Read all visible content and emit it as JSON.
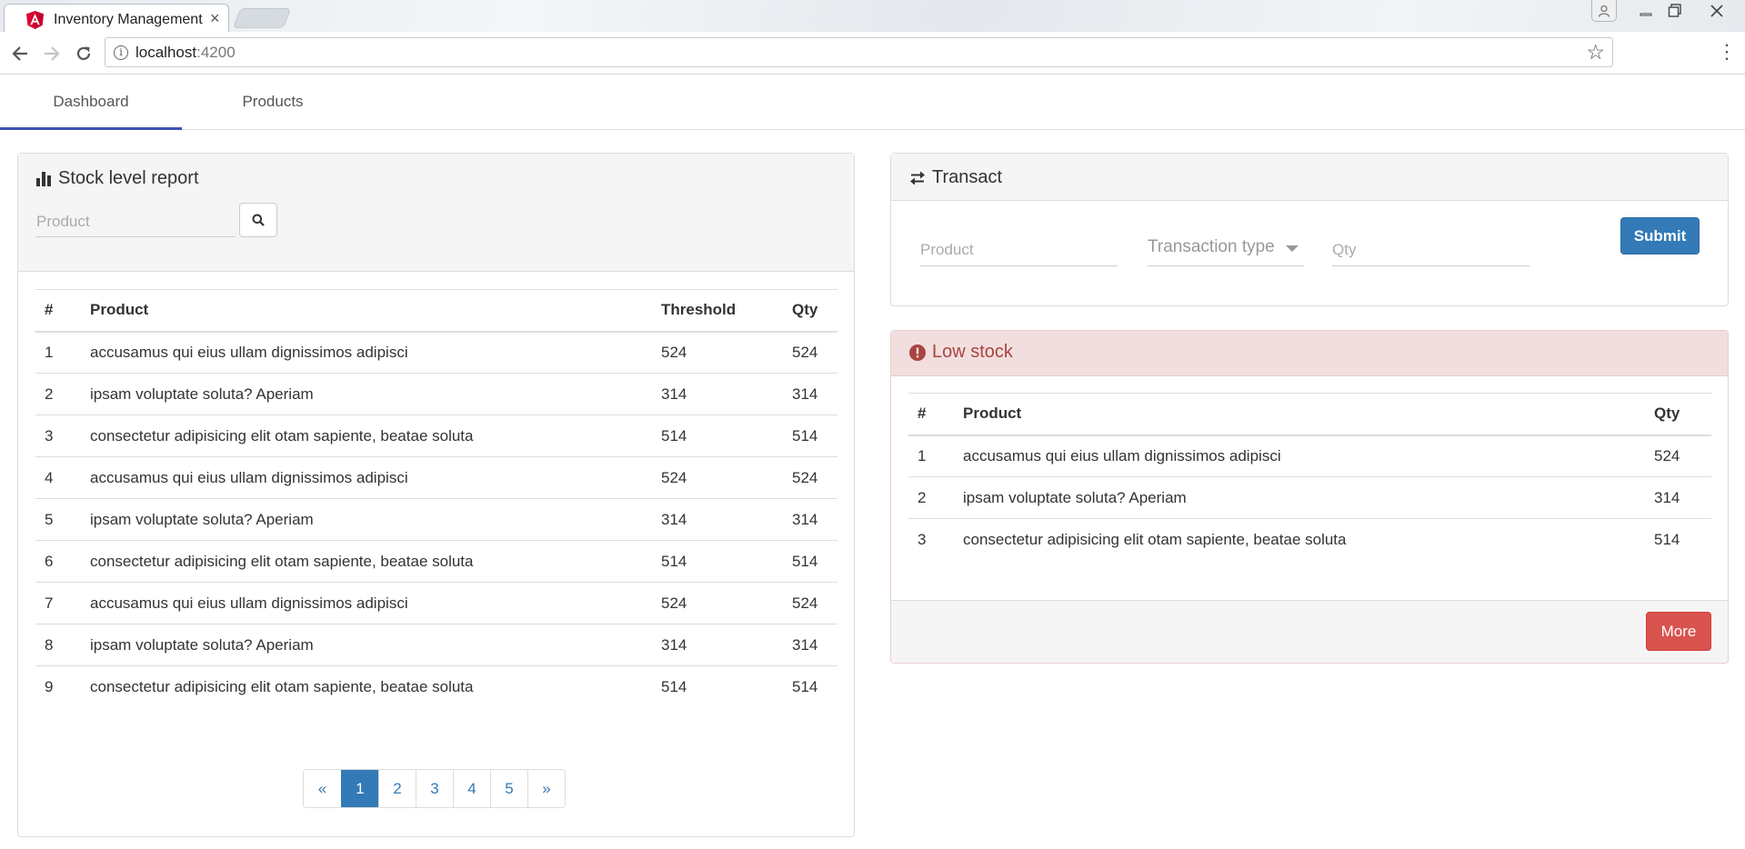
{
  "browser": {
    "tab_title": "Inventory Management",
    "url_host": "localhost",
    "url_port": ":4200"
  },
  "nav": {
    "tabs": [
      {
        "label": "Dashboard",
        "active": true
      },
      {
        "label": "Products",
        "active": false
      }
    ]
  },
  "stock_report": {
    "title": "Stock level report",
    "search_placeholder": "Product",
    "columns": [
      "#",
      "Product",
      "Threshold",
      "Qty"
    ],
    "rows": [
      {
        "num": "1",
        "product": "accusamus qui eius ullam dignissimos adipisci",
        "threshold": "524",
        "qty": "524"
      },
      {
        "num": "2",
        "product": "ipsam voluptate soluta? Aperiam",
        "threshold": "314",
        "qty": "314"
      },
      {
        "num": "3",
        "product": "consectetur adipisicing elit otam sapiente, beatae soluta",
        "threshold": "514",
        "qty": "514"
      },
      {
        "num": "4",
        "product": "accusamus qui eius ullam dignissimos adipisci",
        "threshold": "524",
        "qty": "524"
      },
      {
        "num": "5",
        "product": "ipsam voluptate soluta? Aperiam",
        "threshold": "314",
        "qty": "314"
      },
      {
        "num": "6",
        "product": "consectetur adipisicing elit otam sapiente, beatae soluta",
        "threshold": "514",
        "qty": "514"
      },
      {
        "num": "7",
        "product": "accusamus qui eius ullam dignissimos adipisci",
        "threshold": "524",
        "qty": "524"
      },
      {
        "num": "8",
        "product": "ipsam voluptate soluta? Aperiam",
        "threshold": "314",
        "qty": "314"
      },
      {
        "num": "9",
        "product": "consectetur adipisicing elit otam sapiente, beatae soluta",
        "threshold": "514",
        "qty": "514"
      }
    ],
    "pagination": {
      "prev": "«",
      "pages": [
        "1",
        "2",
        "3",
        "4",
        "5"
      ],
      "active_page": "1",
      "next": "»"
    }
  },
  "transact": {
    "title": "Transact",
    "product_placeholder": "Product",
    "type_placeholder": "Transaction type",
    "qty_placeholder": "Qty",
    "submit_label": "Submit"
  },
  "low_stock": {
    "title": "Low stock",
    "columns": [
      "#",
      "Product",
      "Qty"
    ],
    "rows": [
      {
        "num": "1",
        "product": "accusamus qui eius ullam dignissimos adipisci",
        "qty": "524"
      },
      {
        "num": "2",
        "product": "ipsam voluptate soluta? Aperiam",
        "qty": "314"
      },
      {
        "num": "3",
        "product": "consectetur adipisicing elit otam sapiente, beatae soluta",
        "qty": "514"
      }
    ],
    "more_label": "More"
  },
  "colors": {
    "primary": "#337ab7",
    "danger": "#d9534f",
    "danger_text": "#a94442",
    "danger_bg": "#f2dede",
    "tab_indicator": "#3f51b5"
  }
}
